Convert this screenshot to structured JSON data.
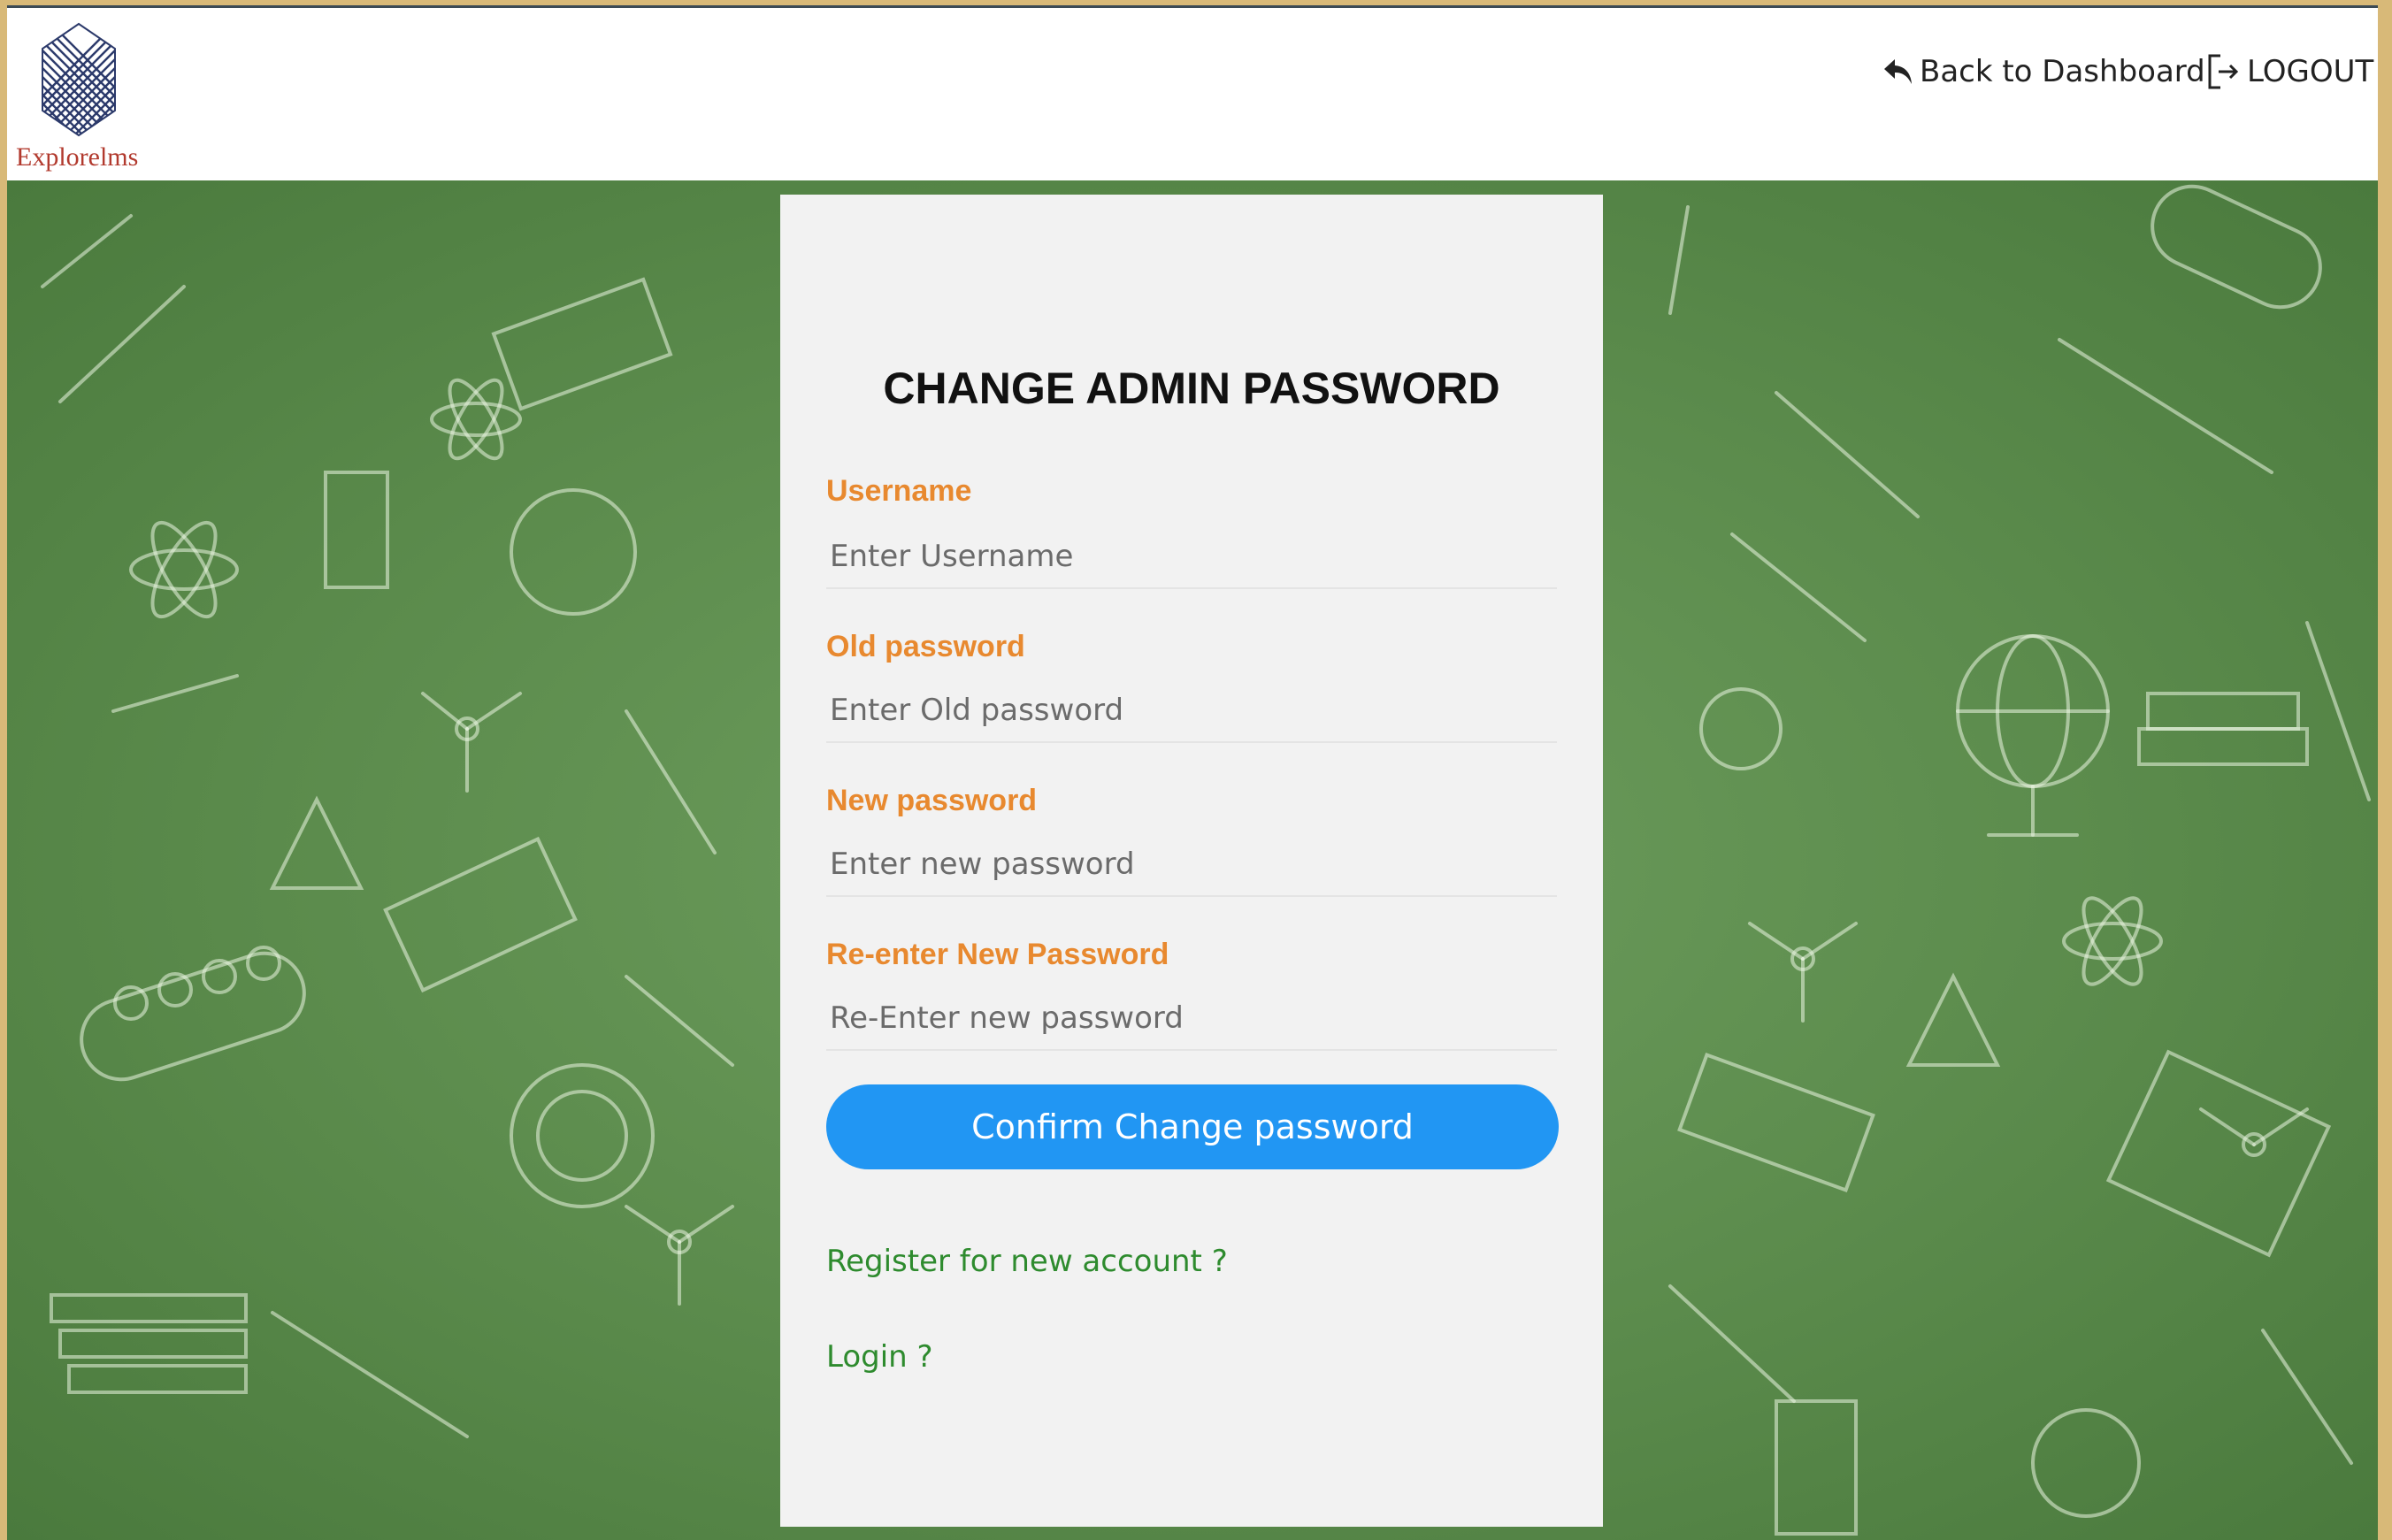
{
  "header": {
    "logo_text": "Explorelms",
    "back_label": "Back to Dashboard",
    "logout_label": "LOGOUT",
    "back_icon": "reply-arrow-icon",
    "logout_icon": "logout-icon"
  },
  "form": {
    "title": "CHANGE ADMIN PASSWORD",
    "fields": [
      {
        "label": "Username",
        "placeholder": "Enter Username",
        "value": ""
      },
      {
        "label": "Old password",
        "placeholder": "Enter Old password",
        "value": ""
      },
      {
        "label": "New password",
        "placeholder": "Enter new password",
        "value": ""
      },
      {
        "label": "Re-enter New Password",
        "placeholder": "Re-Enter new password",
        "value": ""
      }
    ],
    "submit_label": "Confirm Change password",
    "register_link": "Register for new account ?",
    "login_link": "Login ?"
  },
  "colors": {
    "label_orange": "#e8892f",
    "button_blue": "#2196f3",
    "link_green": "#2e8b2e",
    "chalkboard_green": "#5a8a4c"
  }
}
